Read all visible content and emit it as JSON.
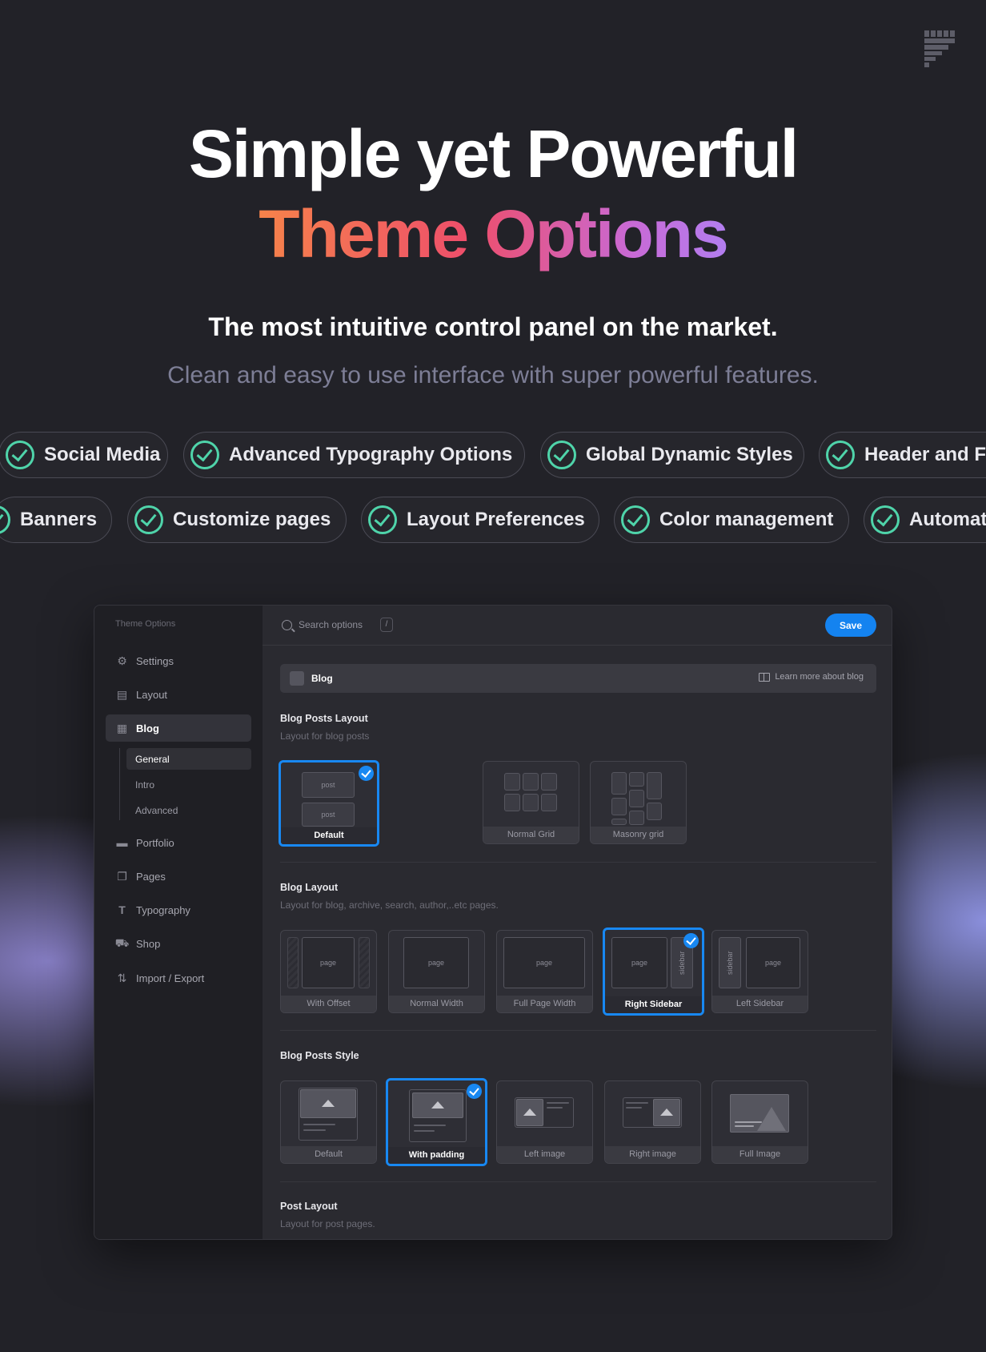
{
  "hero": {
    "title_line1": "Simple yet Powerful",
    "title_line2": "Theme Options",
    "subtitle": "The most intuitive control panel on the market.",
    "description": "Clean and easy to use interface with super powerful features."
  },
  "features_row1": [
    "Social Media",
    "Advanced Typography Options",
    "Global Dynamic Styles",
    "Header and F"
  ],
  "features_row2": [
    "Banners",
    "Customize pages",
    "Layout Preferences",
    "Color management",
    "Automat"
  ],
  "colors": {
    "accent": "#1483f0",
    "check": "#4fd4aa",
    "gradient_start": "#f6834a",
    "gradient_end": "#b27ef0"
  },
  "panel": {
    "sidebar": {
      "title": "Theme Options",
      "items": [
        {
          "label": "Settings",
          "icon": "gear-icon"
        },
        {
          "label": "Layout",
          "icon": "layout-icon"
        },
        {
          "label": "Blog",
          "icon": "blog-icon"
        },
        {
          "label": "Portfolio",
          "icon": "briefcase-icon"
        },
        {
          "label": "Pages",
          "icon": "pages-icon"
        },
        {
          "label": "Typography",
          "icon": "typography-icon"
        },
        {
          "label": "Shop",
          "icon": "cart-icon"
        },
        {
          "label": "Import / Export",
          "icon": "import-export-icon"
        }
      ],
      "blog_sub": [
        "General",
        "Intro",
        "Advanced"
      ]
    },
    "search": {
      "placeholder": "Search options",
      "shortcut": "/"
    },
    "save_label": "Save",
    "section": {
      "title": "Blog",
      "learn_more": "Learn more about blog"
    },
    "blog_posts_layout": {
      "title": "Blog Posts Layout",
      "subtitle": "Layout for blog posts",
      "options": [
        "Default",
        "Normal Grid",
        "Masonry grid"
      ],
      "selected": "Default",
      "post_label": "post"
    },
    "blog_layout": {
      "title": "Blog Layout",
      "subtitle": "Layout for blog, archive, search, author,..etc pages.",
      "options": [
        "With Offset",
        "Normal Width",
        "Full Page Width",
        "Right Sidebar",
        "Left Sidebar"
      ],
      "selected": "Right Sidebar",
      "page_label": "page",
      "sidebar_label": "sidebar"
    },
    "blog_posts_style": {
      "title": "Blog Posts Style",
      "options": [
        "Default",
        "With padding",
        "Left image",
        "Right image",
        "Full Image"
      ],
      "selected": "With padding"
    },
    "post_layout": {
      "title": "Post Layout",
      "subtitle": "Layout for post pages."
    }
  }
}
